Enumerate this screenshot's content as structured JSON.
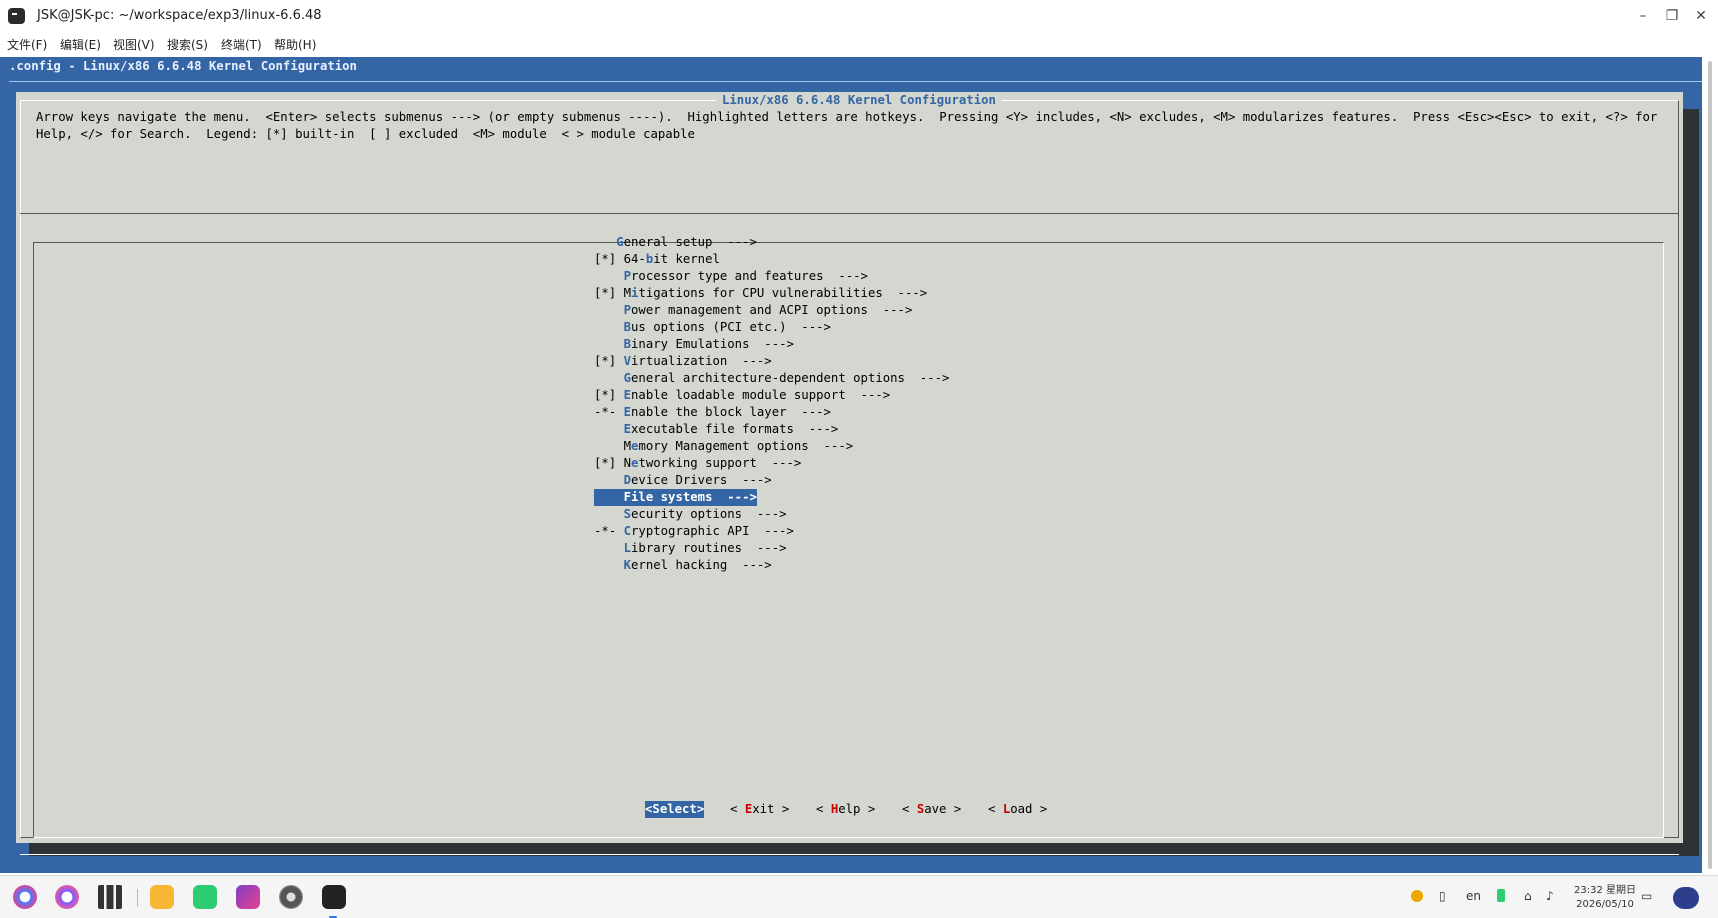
{
  "window": {
    "title": "JSK@JSK-pc: ~/workspace/exp3/linux-6.6.48",
    "minimize": "–",
    "maximize": "❐",
    "close": "✕"
  },
  "menubar": [
    "文件(F)",
    "编辑(E)",
    "视图(V)",
    "搜索(S)",
    "终端(T)",
    "帮助(H)"
  ],
  "terminal": {
    "backtitle": ".config - Linux/x86 6.6.48 Kernel Configuration",
    "dialog_title": "Linux/x86 6.6.48 Kernel Configuration",
    "help_text": "Arrow keys navigate the menu.  <Enter> selects submenus ---> (or empty submenus ----).  Highlighted letters are hotkeys.  Pressing <Y> includes, <N> excludes, <M> modularizes features.  Press <Esc><Esc> to exit, <?> for Help, </> for Search.  Legend: [*] built-in  [ ] excluded  <M> module  < > module capable",
    "menu_entries": [
      {
        "prefix": "   ",
        "before": "",
        "hotkey": "G",
        "after": "eneral setup  --->"
      },
      {
        "prefix": "[*] ",
        "before": "64-",
        "hotkey": "b",
        "after": "it kernel"
      },
      {
        "prefix": "    ",
        "before": "",
        "hotkey": "P",
        "after": "rocessor type and features  --->"
      },
      {
        "prefix": "[*] ",
        "before": "M",
        "hotkey": "i",
        "after": "tigations for CPU vulnerabilities  --->"
      },
      {
        "prefix": "    ",
        "before": "",
        "hotkey": "P",
        "after": "ower management and ACPI options  --->"
      },
      {
        "prefix": "    ",
        "before": "",
        "hotkey": "B",
        "after": "us options (PCI etc.)  --->"
      },
      {
        "prefix": "    ",
        "before": "",
        "hotkey": "B",
        "after": "inary Emulations  --->"
      },
      {
        "prefix": "[*] ",
        "before": "",
        "hotkey": "V",
        "after": "irtualization  --->"
      },
      {
        "prefix": "    ",
        "before": "",
        "hotkey": "G",
        "after": "eneral architecture-dependent options  --->"
      },
      {
        "prefix": "[*] ",
        "before": "",
        "hotkey": "E",
        "after": "nable loadable module support  --->"
      },
      {
        "prefix": "-*- ",
        "before": "",
        "hotkey": "E",
        "after": "nable the block layer  --->"
      },
      {
        "prefix": "    ",
        "before": "",
        "hotkey": "E",
        "after": "xecutable file formats  --->"
      },
      {
        "prefix": "    ",
        "before": "M",
        "hotkey": "e",
        "after": "mory Management options  --->"
      },
      {
        "prefix": "[*] ",
        "before": "N",
        "hotkey": "e",
        "after": "tworking support  --->"
      },
      {
        "prefix": "    ",
        "before": "",
        "hotkey": "D",
        "after": "evice Drivers  --->"
      },
      {
        "prefix": "    ",
        "before": "",
        "hotkey": "F",
        "after": "ile systems  --->"
      },
      {
        "prefix": "    ",
        "before": "",
        "hotkey": "S",
        "after": "ecurity options  --->"
      },
      {
        "prefix": "-*- ",
        "before": "",
        "hotkey": "C",
        "after": "ryptographic API  --->"
      },
      {
        "prefix": "    ",
        "before": "",
        "hotkey": "L",
        "after": "ibrary routines  --->"
      },
      {
        "prefix": "    ",
        "before": "",
        "hotkey": "K",
        "after": "ernel hacking  --->"
      }
    ],
    "selected_entry": "File systems",
    "buttons": [
      {
        "open": "<",
        "hotkey": "S",
        "rest": "elect",
        "close": ">",
        "selected": true
      },
      {
        "open": "< ",
        "hotkey": "E",
        "rest": "xit",
        "close": " >",
        "selected": false
      },
      {
        "open": "< ",
        "hotkey": "H",
        "rest": "elp",
        "close": " >",
        "selected": false
      },
      {
        "open": "< ",
        "hotkey": "S",
        "rest": "ave",
        "close": " >",
        "selected": false
      },
      {
        "open": "< ",
        "hotkey": "L",
        "rest": "oad",
        "close": " >",
        "selected": false
      }
    ]
  },
  "taskbar": {
    "apps": [
      "launcher-icon",
      "search-icon",
      "multitask-view-icon",
      "file-manager-icon",
      "chat-icon",
      "camera-app-icon",
      "settings-icon",
      "terminal-icon"
    ],
    "tray": {
      "lang": "en",
      "time": "23:32 星期日",
      "date": "2026/05/10"
    }
  },
  "colors": {
    "terminal_blue": "#3465a4",
    "dialog_gray": "#d3d7cf",
    "hotkey_red": "#cc0000"
  }
}
